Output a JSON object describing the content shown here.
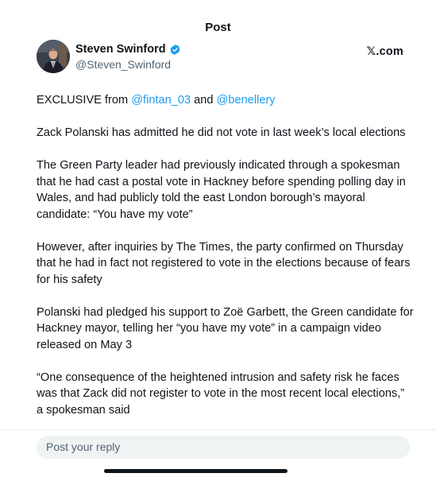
{
  "header": {
    "title": "Post"
  },
  "post": {
    "author": {
      "display_name": "Steven Swinford",
      "handle": "@Steven_Swinford",
      "verified": true,
      "avatar_icon": "person-photo-icon"
    },
    "source_label": "𝕏.com",
    "intro": {
      "prefix": "EXCLUSIVE from ",
      "mention_1": "@fintan_03",
      "joiner": " and ",
      "mention_2": "@benellery"
    },
    "paragraphs": [
      "Zack Polanski has admitted he did not vote in last week’s local elections",
      "The Green Party leader had previously indicated through a spokesman that he had cast a postal vote in Hackney before spending polling day in Wales, and had publicly told the east London borough’s mayoral candidate: “You have my vote”",
      "However, after inquiries by The Times, the party confirmed on Thursday that he had in fact not registered to vote in the elections because of fears for his safety",
      "Polanski had pledged his support to Zoë Garbett, the Green candidate for Hackney mayor, telling her “you have my vote” in a campaign video released on May 3",
      "“One consequence of the heightened intrusion and safety risk he faces was that Zack did not register to vote in the most recent local elections,” a spokesman said"
    ]
  },
  "reply": {
    "placeholder": "Post your reply"
  },
  "colors": {
    "text": "#0f1419",
    "secondary": "#536471",
    "link": "#1d9bf0",
    "verified_badge": "#1d9bf0",
    "reply_bg": "#eff3f4"
  }
}
